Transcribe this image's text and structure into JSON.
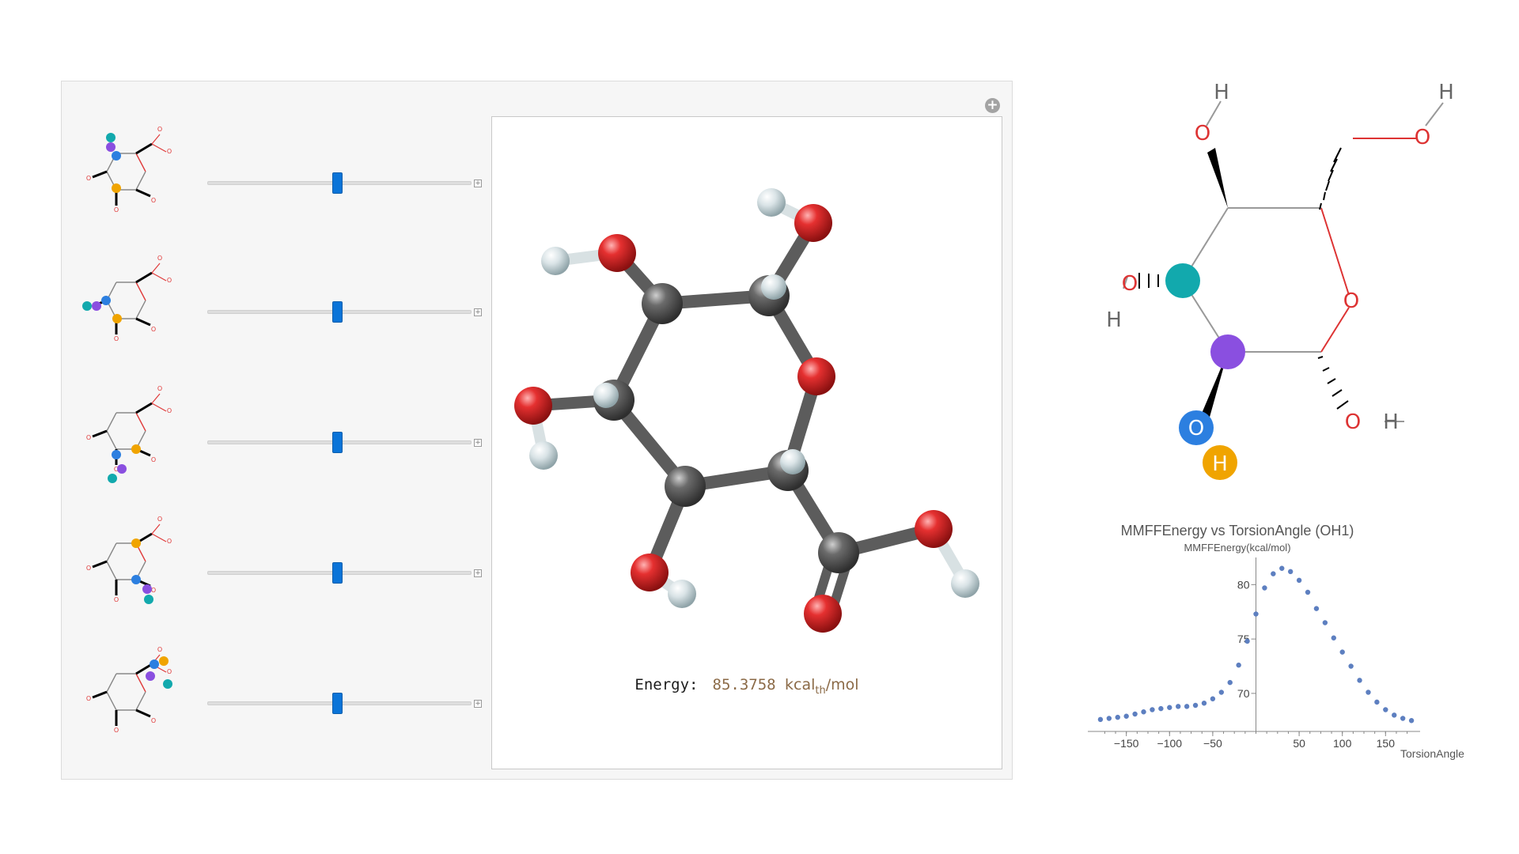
{
  "controls": {
    "add_symbol": "+",
    "expand_symbol": "+",
    "sliders": [
      {
        "label_hint": "torsion-1",
        "value": 0.5
      },
      {
        "label_hint": "torsion-2",
        "value": 0.5
      },
      {
        "label_hint": "torsion-3",
        "value": 0.5
      },
      {
        "label_hint": "torsion-4",
        "value": 0.5
      },
      {
        "label_hint": "torsion-5",
        "value": 0.5
      }
    ]
  },
  "viewer": {
    "energy_label": "Energy:",
    "energy_value": "85.3758",
    "energy_unit_main": "kcal",
    "energy_unit_sub": "th",
    "energy_unit_tail": "/mol"
  },
  "atoms": {
    "O": "O",
    "H": "H"
  },
  "colors": {
    "oxygen": "#e03b3b",
    "carbon": "#5c5c5c",
    "hydrogen": "#dfe8ea",
    "teal": "#12a9ad",
    "purple": "#8a4fe0",
    "blue": "#2c7fe0",
    "orange": "#f0a400",
    "slider": "#0a74d8",
    "plot_points": "#5d7fc0"
  },
  "chart_data": {
    "type": "scatter",
    "title": "MMFFEnergy vs TorsionAngle (OH1)",
    "ylabel": "MMFFEnergy(kcal/mol)",
    "xlabel": "TorsionAngle",
    "xlim": [
      -190,
      190
    ],
    "ylim": [
      66.5,
      82.5
    ],
    "xticks": [
      -150,
      -100,
      -50,
      50,
      100,
      150
    ],
    "yticks": [
      70,
      75,
      80
    ],
    "x": [
      -180,
      -170,
      -160,
      -150,
      -140,
      -130,
      -120,
      -110,
      -100,
      -90,
      -80,
      -70,
      -60,
      -50,
      -40,
      -30,
      -20,
      -10,
      0,
      10,
      20,
      30,
      40,
      50,
      60,
      70,
      80,
      90,
      100,
      110,
      120,
      130,
      140,
      150,
      160,
      170,
      180
    ],
    "y": [
      67.6,
      67.7,
      67.8,
      67.9,
      68.1,
      68.3,
      68.5,
      68.6,
      68.7,
      68.8,
      68.8,
      68.9,
      69.1,
      69.5,
      70.1,
      71.0,
      72.6,
      74.8,
      77.3,
      79.7,
      81.0,
      81.5,
      81.2,
      80.4,
      79.3,
      77.8,
      76.5,
      75.1,
      73.8,
      72.5,
      71.2,
      70.1,
      69.2,
      68.5,
      68.0,
      67.7,
      67.5
    ]
  }
}
